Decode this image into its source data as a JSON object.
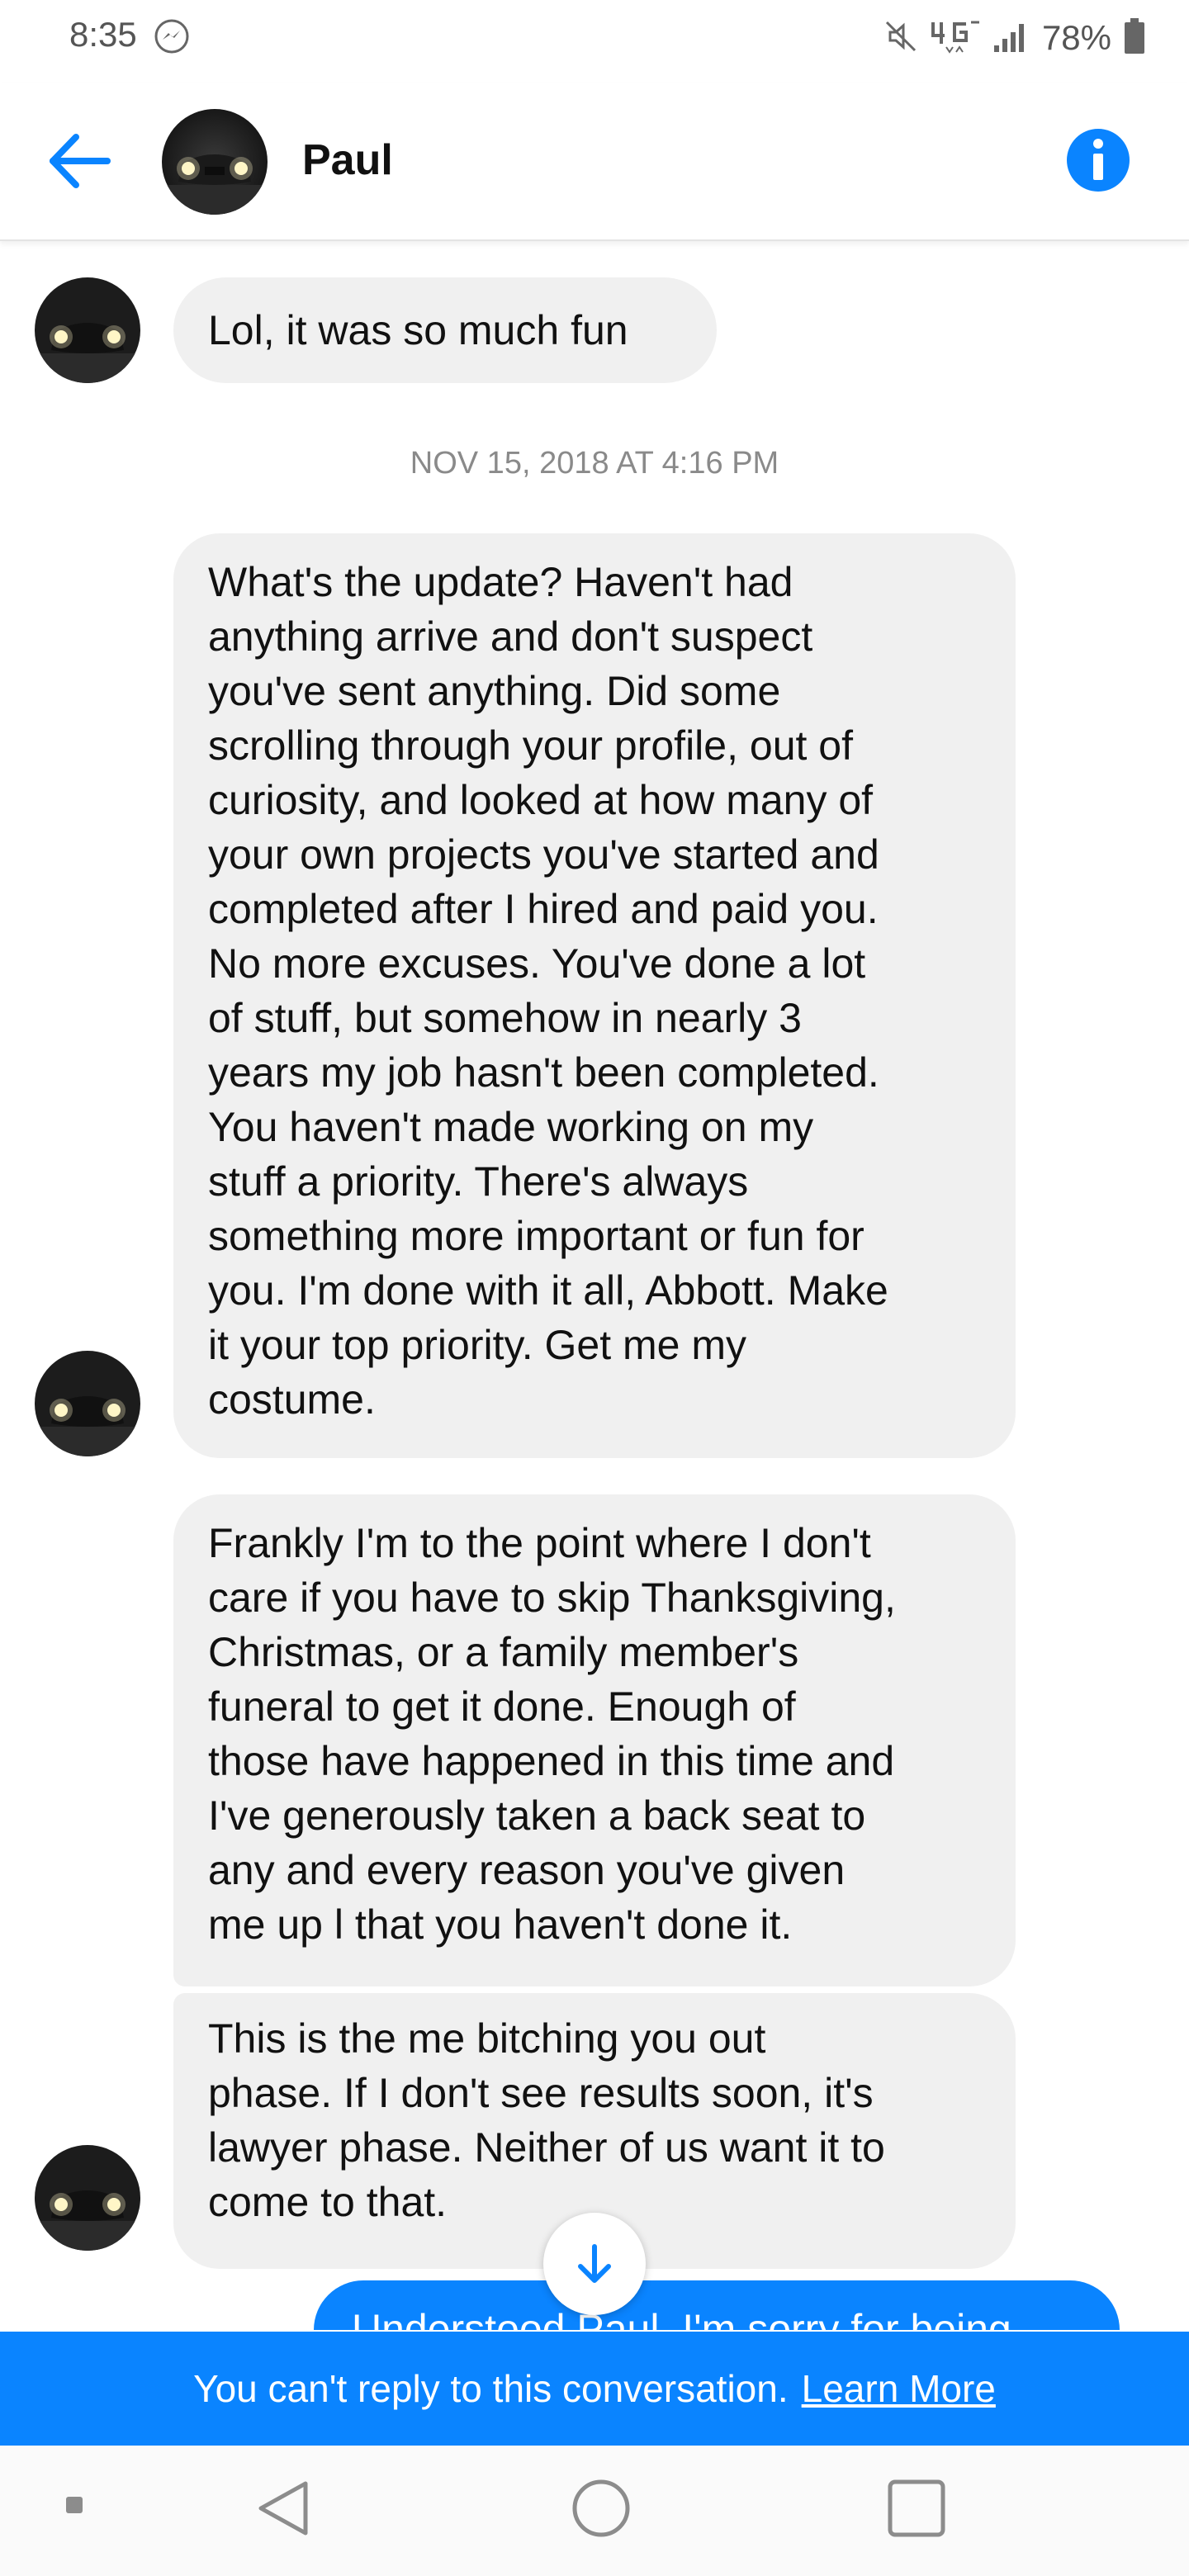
{
  "status_bar": {
    "time": "8:35",
    "battery": "78%",
    "icons": [
      "messenger-icon",
      "mute-icon",
      "4g-icon",
      "signal-icon",
      "battery-icon"
    ]
  },
  "header": {
    "contact_name": "Paul",
    "icons": [
      "back-arrow-icon",
      "info-icon"
    ]
  },
  "conversation": {
    "timestamp": "NOV 15, 2018 AT 4:16 PM",
    "messages": [
      {
        "direction": "incoming",
        "text": "Lol, it was so much fun"
      },
      {
        "direction": "incoming",
        "text": "What's the update? Haven't had\nanything arrive and don't suspect\nyou've sent anything. Did some\nscrolling through your profile, out of\ncuriosity, and looked at how many of\nyour own projects you've started and\ncompleted after I hired and paid you.\nNo more excuses. You've done a lot\nof stuff, but somehow in nearly 3\nyears my job hasn't been completed.\nYou haven't made working on my\nstuff a priority. There's always\nsomething more important or fun for\nyou. I'm done with it all, Abbott. Make\nit your top priority. Get me my\ncostume."
      },
      {
        "direction": "incoming",
        "text": "Frankly I'm to the point where I don't\ncare if you have to skip Thanksgiving,\nChristmas, or a family member's\nfuneral to get it done. Enough of\nthose have happened in this time and\nI've generously taken a back seat to\nany and every reason you've given\nme up l that you haven't done it."
      },
      {
        "direction": "incoming",
        "text": "This is the me bitching you out\nphase. If I don't see results soon, it's\nlawyer phase. Neither of us want it to\ncome to that."
      },
      {
        "direction": "outgoing",
        "text": "Understood Paul. I'm sorry for being"
      }
    ]
  },
  "notice": {
    "text": "You can't reply to this conversation.",
    "link": "Learn More"
  },
  "colors": {
    "accent": "#0a84ff",
    "incoming_bubble": "#f0f0f0",
    "timestamp_text": "#8a8a8a"
  }
}
